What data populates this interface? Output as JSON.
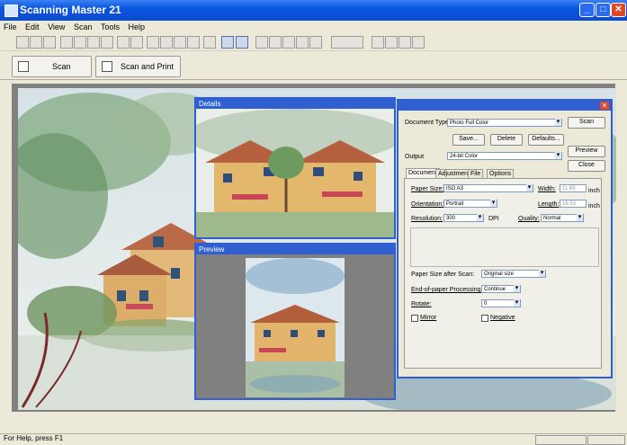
{
  "window": {
    "title": "Scanning Master 21"
  },
  "menu": [
    "File",
    "Edit",
    "View",
    "Scan",
    "Tools",
    "Help"
  ],
  "scanbar": {
    "scan_label": "Scan",
    "scan_print_label": "Scan and Print"
  },
  "details": {
    "title": "Details"
  },
  "preview": {
    "title": "Preview"
  },
  "settings": {
    "document_type_label": "Document Type:",
    "document_type_value": "Photo Full Color",
    "scan_button": "Scan",
    "save_button": "Save...",
    "delete_button": "Delete",
    "defaults_button": "Defaults...",
    "preview_button": "Preview",
    "close_button": "Close",
    "output_label": "Output",
    "output_value": "24-bit Color",
    "tabs": [
      "Document",
      "Adjustments",
      "File",
      "Options"
    ],
    "paper_size_label": "Paper Size:",
    "paper_size_value": "ISO A3",
    "width_label": "Width:",
    "width_value": "11.69",
    "width_unit": "inch",
    "orientation_label": "Orientation:",
    "orientation_value": "Portrait",
    "length_label": "Length:",
    "length_value": "16.53",
    "length_unit": "inch",
    "resolution_label": "Resolution:",
    "resolution_value": "300",
    "dpi_label": "DPI",
    "quality_label": "Quality:",
    "quality_value": "Normal",
    "paper_after_scan_label": "Paper Size after Scan:",
    "paper_after_scan_value": "Original size",
    "end_paper_label": "End-of-paper Processing:",
    "end_paper_value": "Continue",
    "rotate_label": "Rotate:",
    "rotate_value": "0",
    "mirror_label": "Mirror",
    "negative_label": "Negative"
  },
  "status": {
    "text": "For Help, press F1"
  }
}
